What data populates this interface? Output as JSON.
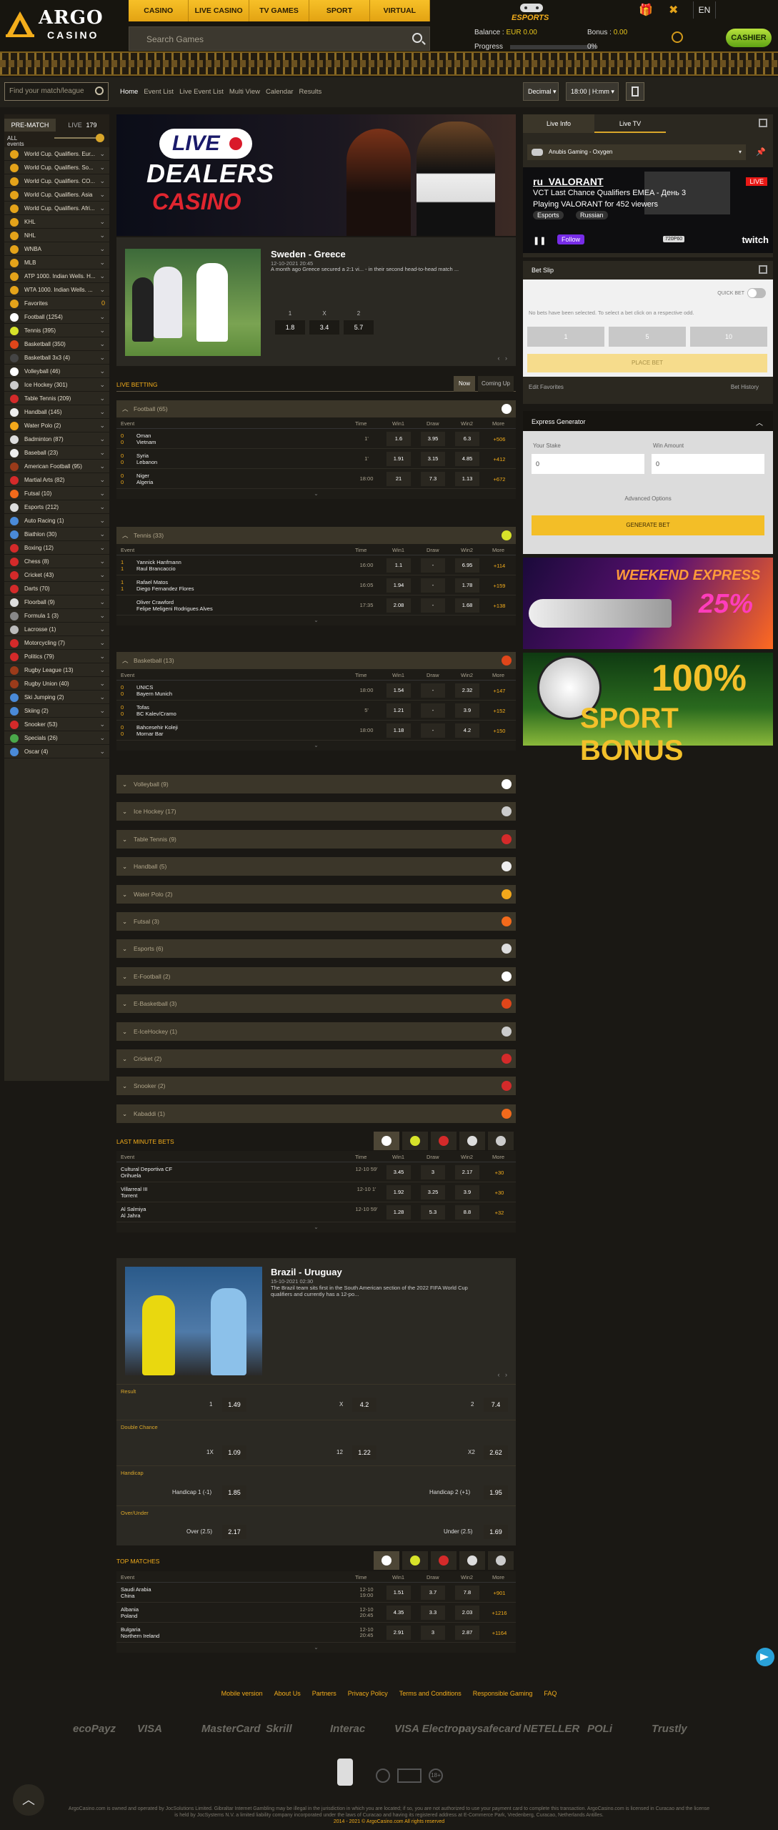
{
  "header": {
    "logo_top": "ARGO",
    "logo_bottom": "CASINO",
    "nav": [
      "CASINO",
      "LIVE CASINO",
      "TV GAMES",
      "SPORT",
      "VIRTUAL SPORT"
    ],
    "search_placeholder": "Search Games",
    "esports_label": "ESPORTS",
    "language": "EN",
    "balance_label": "Balance :",
    "balance_value": "EUR 0.00",
    "bonus_label": "Bonus :",
    "bonus_value": "0.00",
    "progress_label": "Progress",
    "progress_value": "0%",
    "progress_fraction": 0,
    "cashier_label": "CASHIER"
  },
  "subbar": {
    "find_placeholder": "Find your match/league",
    "crumbs": [
      "Home",
      "Event List",
      "Live Event List",
      "Multi View",
      "Calendar",
      "Results"
    ],
    "odds_format": "Decimal",
    "time_format": "18:00 | H:mm"
  },
  "sidebar": {
    "tab_prematch": "PRE-MATCH",
    "tab_live": "LIVE",
    "live_count": "179",
    "all_events": "ALL events",
    "items": [
      {
        "label": "World Cup. Qualifiers. Eur...",
        "color": "#e4a31a"
      },
      {
        "label": "World Cup. Qualifiers. So...",
        "color": "#e4a31a"
      },
      {
        "label": "World Cup. Qualifiers. CO...",
        "color": "#e4a31a"
      },
      {
        "label": "World Cup. Qualifiers. Asia",
        "color": "#e4a31a"
      },
      {
        "label": "World Cup. Qualifiers. Afri...",
        "color": "#e4a31a"
      },
      {
        "label": "KHL",
        "color": "#e4a31a"
      },
      {
        "label": "NHL",
        "color": "#e4a31a"
      },
      {
        "label": "WNBA",
        "color": "#e4a31a"
      },
      {
        "label": "MLB",
        "color": "#e4a31a"
      },
      {
        "label": "ATP 1000. Indian Wells. H...",
        "color": "#e4a31a"
      },
      {
        "label": "WTA 1000. Indian Wells. ...",
        "color": "#e4a31a"
      },
      {
        "label": "Favorites",
        "count": "0",
        "color": "#e4a31a"
      },
      {
        "label": "Football (1254)",
        "color": "#ffffff"
      },
      {
        "label": "Tennis (395)",
        "color": "#d7e32a"
      },
      {
        "label": "Basketball (350)",
        "color": "#e0461a"
      },
      {
        "label": "Basketball 3x3 (4)",
        "color": "#444444"
      },
      {
        "label": "Volleyball (46)",
        "color": "#ffffff"
      },
      {
        "label": "Ice Hockey (301)",
        "color": "#cccccc"
      },
      {
        "label": "Table Tennis (209)",
        "color": "#d42a2a"
      },
      {
        "label": "Handball (145)",
        "color": "#eeeeee"
      },
      {
        "label": "Water Polo (2)",
        "color": "#f3a81b"
      },
      {
        "label": "Badminton (87)",
        "color": "#dddddd"
      },
      {
        "label": "Baseball (23)",
        "color": "#eeeeee"
      },
      {
        "label": "American Football (95)",
        "color": "#9b3b1a"
      },
      {
        "label": "Martial Arts (82)",
        "color": "#d42a2a"
      },
      {
        "label": "Futsal (10)",
        "color": "#f36a1b"
      },
      {
        "label": "Esports (212)",
        "color": "#dddddd"
      },
      {
        "label": "Auto Racing (1)",
        "color": "#4a8ad8"
      },
      {
        "label": "Biathlon (30)",
        "color": "#4a8ad8"
      },
      {
        "label": "Boxing (12)",
        "color": "#d42a2a"
      },
      {
        "label": "Chess (8)",
        "color": "#d42a2a"
      },
      {
        "label": "Cricket (43)",
        "color": "#d42a2a"
      },
      {
        "label": "Darts (70)",
        "color": "#d42a2a"
      },
      {
        "label": "Floorball (9)",
        "color": "#dddddd"
      },
      {
        "label": "Formula 1 (3)",
        "color": "#888888"
      },
      {
        "label": "Lacrosse (1)",
        "color": "#bbbbbb"
      },
      {
        "label": "Motorcycling (7)",
        "color": "#d42a2a"
      },
      {
        "label": "Politics (79)",
        "color": "#d42a2a"
      },
      {
        "label": "Rugby League (13)",
        "color": "#9b3b1a"
      },
      {
        "label": "Rugby Union (40)",
        "color": "#9b3b1a"
      },
      {
        "label": "Ski Jumping (2)",
        "color": "#4a8ad8"
      },
      {
        "label": "Skiing (2)",
        "color": "#4a8ad8"
      },
      {
        "label": "Snooker (53)",
        "color": "#d42a2a"
      },
      {
        "label": "Specials (26)",
        "color": "#4aa84a"
      },
      {
        "label": "Oscar (4)",
        "color": "#4a8ad8"
      }
    ]
  },
  "banner": {
    "live": "LIVE",
    "dealers": "DEALERS",
    "casino": "CASINO"
  },
  "featured": {
    "title": "Sweden - Greece",
    "date": "12-10-2021 20:45",
    "desc": "A month ago Greece secured a 2:1 vi... - in their second head-to-head match ...",
    "labels": [
      "1",
      "X",
      "2"
    ],
    "odds": [
      "1.8",
      "3.4",
      "5.7"
    ]
  },
  "live_betting": {
    "title": "LIVE BETTING",
    "tab_now": "Now",
    "tab_coming": "Coming Up",
    "columns": [
      "Event",
      "Time",
      "Win1",
      "Draw",
      "Win2",
      "More"
    ],
    "sections": [
      {
        "name": "Football",
        "count": "(65)",
        "rows": [
          {
            "s1": "0",
            "s2": "0",
            "t1": "Oman",
            "t2": "Vietnam",
            "time": "1'",
            "w1": "1.6",
            "d": "3.95",
            "w2": "6.3",
            "more": "+506"
          },
          {
            "s1": "0",
            "s2": "0",
            "t1": "Syria",
            "t2": "Lebanon",
            "time": "1'",
            "w1": "1.91",
            "d": "3.15",
            "w2": "4.85",
            "more": "+412"
          },
          {
            "s1": "0",
            "s2": "0",
            "t1": "Niger",
            "t2": "Algeria",
            "time": "18:00",
            "w1": "21",
            "d": "7.3",
            "w2": "1.13",
            "more": "+672"
          }
        ]
      },
      {
        "name": "Tennis",
        "count": "(33)",
        "rows": [
          {
            "s1": "1",
            "s2": "1",
            "t1": "Yannick Hanfmann",
            "t2": "Raul Brancaccio",
            "time": "16:00",
            "w1": "1.1",
            "d": "-",
            "w2": "6.95",
            "more": "+114"
          },
          {
            "s1": "1",
            "s2": "1",
            "t1": "Rafael Matos",
            "t2": "Diego Fernandez Flores",
            "time": "16:05",
            "w1": "1.94",
            "d": "-",
            "w2": "1.78",
            "more": "+159"
          },
          {
            "s1": "",
            "s2": "",
            "t1": "Oliver Crawford",
            "t2": "Felipe Meligeni Rodrigues Alves",
            "time": "17:35",
            "w1": "2.08",
            "d": "-",
            "w2": "1.68",
            "more": "+138"
          }
        ]
      },
      {
        "name": "Basketball",
        "count": "(13)",
        "rows": [
          {
            "s1": "0",
            "s2": "0",
            "t1": "UNICS",
            "t2": "Bayern Munich",
            "time": "18:00",
            "w1": "1.54",
            "d": "-",
            "w2": "2.32",
            "more": "+147"
          },
          {
            "s1": "0",
            "s2": "0",
            "t1": "Tofas",
            "t2": "BC Kalev/Cramo",
            "time": "5'",
            "w1": "1.21",
            "d": "-",
            "w2": "3.9",
            "more": "+152"
          },
          {
            "s1": "0",
            "s2": "0",
            "t1": "Bahcesehir Koleji",
            "t2": "Mornar Bar",
            "time": "18:00",
            "w1": "1.18",
            "d": "-",
            "w2": "4.2",
            "more": "+150"
          }
        ]
      }
    ],
    "collapsed": [
      {
        "name": "Volleyball",
        "count": "(9)",
        "color": "#ffffff"
      },
      {
        "name": "Ice Hockey",
        "count": "(17)",
        "color": "#cccccc"
      },
      {
        "name": "Table Tennis",
        "count": "(9)",
        "color": "#d42a2a"
      },
      {
        "name": "Handball",
        "count": "(5)",
        "color": "#eeeeee"
      },
      {
        "name": "Water Polo",
        "count": "(2)",
        "color": "#f3a81b"
      },
      {
        "name": "Futsal",
        "count": "(3)",
        "color": "#f36a1b"
      },
      {
        "name": "Esports",
        "count": "(6)",
        "color": "#dddddd"
      },
      {
        "name": "E-Football",
        "count": "(2)",
        "color": "#ffffff"
      },
      {
        "name": "E-Basketball",
        "count": "(3)",
        "color": "#e0461a"
      },
      {
        "name": "E-IceHockey",
        "count": "(1)",
        "color": "#cccccc"
      },
      {
        "name": "Cricket",
        "count": "(2)",
        "color": "#d42a2a"
      },
      {
        "name": "Snooker",
        "count": "(2)",
        "color": "#d42a2a"
      },
      {
        "name": "Kabaddi",
        "count": "(1)",
        "color": "#f36a1b"
      }
    ]
  },
  "last_minute": {
    "title": "LAST MINUTE BETS",
    "rows": [
      {
        "t1": "Cultural Deportiva CF",
        "t2": "Orihuela",
        "time": "12-10 59'",
        "w1": "3.45",
        "d": "3",
        "w2": "2.17",
        "more": "+30"
      },
      {
        "t1": "Villarreal III",
        "t2": "Torrent",
        "time": "12-10 1'",
        "w1": "1.92",
        "d": "3.25",
        "w2": "3.9",
        "more": "+30"
      },
      {
        "t1": "Al Salmiya",
        "t2": "Al Jahra",
        "time": "12-10 59'",
        "w1": "1.28",
        "d": "5.3",
        "w2": "8.8",
        "more": "+32"
      }
    ]
  },
  "featured2": {
    "title": "Brazil - Uruguay",
    "date": "15-10-2021 02:30",
    "desc1": "The Brazil team sits first in the South American section of the 2022 FIFA World Cup",
    "desc2": "qualifiers and currently has a 12-po...",
    "result_label": "Result",
    "r1": "1",
    "r1v": "1.49",
    "rx": "X",
    "rxv": "4.2",
    "r2": "2",
    "r2v": "7.4",
    "dc_label": "Double Chance",
    "dc1": "1X",
    "dc1v": "1.09",
    "dc2": "12",
    "dc2v": "1.22",
    "dc3": "X2",
    "dc3v": "2.62",
    "hc_label": "Handicap",
    "hc1": "Handicap 1 (-1)",
    "hc1v": "1.85",
    "hc2": "Handicap 2 (+1)",
    "hc2v": "1.95",
    "ou_label": "Over/Under",
    "ou1": "Over (2.5)",
    "ou1v": "2.17",
    "ou2": "Under (2.5)",
    "ou2v": "1.69"
  },
  "top_matches": {
    "title": "TOP MATCHES",
    "rows": [
      {
        "t1": "Saudi Arabia",
        "t2": "China",
        "time": "12-10 19:00",
        "w1": "1.51",
        "d": "3.7",
        "w2": "7.8",
        "more": "+901"
      },
      {
        "t1": "Albania",
        "t2": "Poland",
        "time": "12-10 20:45",
        "w1": "4.35",
        "d": "3.3",
        "w2": "2.03",
        "more": "+1216"
      },
      {
        "t1": "Bulgaria",
        "t2": "Northern Ireland",
        "time": "12-10 20:45",
        "w1": "2.91",
        "d": "3",
        "w2": "2.87",
        "more": "+1164"
      }
    ]
  },
  "right": {
    "tab_info": "Live Info",
    "tab_tv": "Live TV",
    "stream_select": "Anubis Gaming - Oxygen",
    "stream_channel": "ru_VALORANT",
    "stream_title": "VCT Last Chance Qualifiers EMEA - День 3",
    "stream_sub": "Playing VALORANT for 452 viewers",
    "stream_tags": [
      "Esports",
      "Russian"
    ],
    "stream_follow": "Follow",
    "stream_quality": "720P60",
    "stream_live": "LIVE",
    "stream_brand": "twitch",
    "betslip_title": "Bet Slip",
    "quick_bet": "QUICK BET",
    "betslip_empty": "No bets have been selected. To select a bet click on a respective odd.",
    "quick_amounts": [
      "1",
      "5",
      "10"
    ],
    "place_bet": "PLACE BET",
    "edit_fav": "Edit Favorites",
    "bet_history": "Bet History",
    "express_title": "Express Generator",
    "stake_label": "Your Stake",
    "stake_value": "0",
    "win_label": "Win Amount",
    "win_value": "0",
    "advanced": "Advanced Options",
    "generate": "GENERATE BET",
    "promo1_title": "WEEKEND EXPRESS",
    "promo1_value": "25%",
    "promo2_title": "100%",
    "promo2_value": "SPORT BONUS"
  },
  "footer": {
    "links": [
      "Mobile version",
      "About Us",
      "Partners",
      "Privacy Policy",
      "Terms and Conditions",
      "Responsible Gaming",
      "FAQ"
    ],
    "payments": [
      "ecoPayz",
      "VISA",
      "MasterCard",
      "Skrill",
      "Interac",
      "VISA Electron",
      "paysafecard",
      "NETELLER",
      "POLi",
      "Trustly"
    ],
    "copy1": "ArgoCasino.com is owned and operated by JocSolutions Limited. Gibraltar Internet Gambling may be illegal in the jurisdiction in which you are located; if so, you are not authorized to use your payment card to complete this transaction. ArgoCasino.com is licensed in Curacao and the license",
    "copy2": "is held by JocSystems N.V. a limited liability company incorporated under the laws of Curacao and having its registered address at E-Commerce Park, Vredenberg, Curacao, Netherlands Antilles.",
    "copy3": "2014 - 2021 © ArgoCasino.com All rights reserved"
  }
}
